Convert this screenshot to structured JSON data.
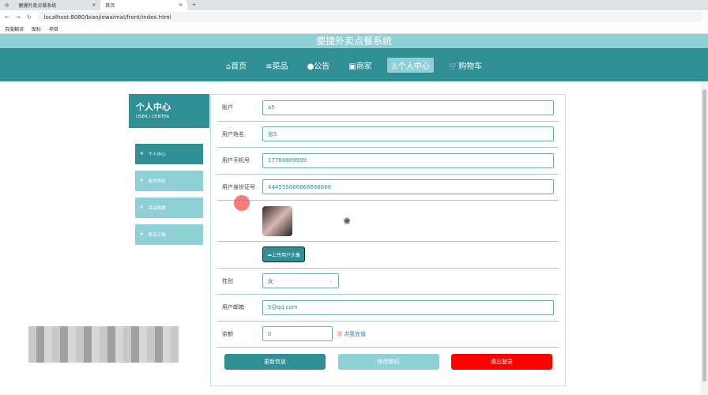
{
  "browser": {
    "tabs": [
      {
        "title": "便捷外卖点餐系统"
      },
      {
        "title": "首页"
      }
    ],
    "url": "localhost:8080/bianjiewaimai/front/index.html",
    "bookmarks": [
      "百度翻译",
      "图标",
      "项目"
    ]
  },
  "site_title": "便捷外卖点餐系统",
  "nav": [
    {
      "icon": "home-icon",
      "label": "⌂首页"
    },
    {
      "icon": "menu-icon",
      "label": "≡菜品"
    },
    {
      "icon": "notice-icon",
      "label": "●公告"
    },
    {
      "icon": "shop-icon",
      "label": "▣商家"
    },
    {
      "icon": "user-icon",
      "label": "♙个人中心",
      "active": true
    },
    {
      "icon": "cart-icon",
      "label": "🛒购物车"
    }
  ],
  "sidebar": {
    "title": "个人中心",
    "subtitle": "USER / CENTER",
    "items": [
      {
        "label": "个人中心",
        "active": true
      },
      {
        "label": "收货地址"
      },
      {
        "label": "菜品收藏"
      },
      {
        "label": "菜品订单"
      }
    ]
  },
  "form": {
    "account": {
      "label": "账户",
      "value": "a5"
    },
    "name": {
      "label": "用户姓名",
      "value": "张5"
    },
    "phone": {
      "label": "用户手机号",
      "value": "17788889999"
    },
    "idcard": {
      "label": "用户身份证号",
      "value": "444555666666666666"
    },
    "upload_label": "上传用户头像",
    "gender": {
      "label": "性别",
      "value": "女"
    },
    "email": {
      "label": "用户邮箱",
      "value": "5@qq.com"
    },
    "balance": {
      "label": "余额",
      "value": "0",
      "recharge": "点我充值"
    }
  },
  "buttons": {
    "update": "更新信息",
    "password": "修改密码",
    "logout": "退出登录"
  },
  "colors": {
    "primary": "#2f8f95",
    "light": "#8fcfd6",
    "danger": "#ff0000"
  }
}
